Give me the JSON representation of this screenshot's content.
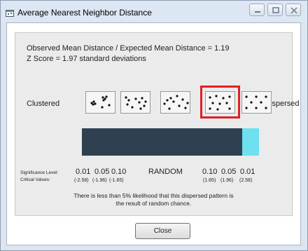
{
  "window": {
    "title": "Average Nearest Neighbor Distance"
  },
  "results": {
    "ratio_text": "Observed Mean Distance / Expected Mean Distance = 1.19",
    "zscore_text": "Z Score = 1.97 standard deviations"
  },
  "pattern_scale": {
    "left_label": "Clustered",
    "right_label": "Dispersed",
    "selected_index": 3,
    "thumbnail_count": 5
  },
  "significance": {
    "level_label": "Significance Level:",
    "critical_label": "Critical Values:",
    "left_levels": [
      "0.01",
      "0.05",
      "0.10"
    ],
    "left_criticals": [
      "(-2.58)",
      "(-1.96)",
      "(-1.65)"
    ],
    "center_label": "RANDOM",
    "right_levels": [
      "0.10",
      "0.05",
      "0.01"
    ],
    "right_criticals": [
      "(1.65)",
      "(1.96)",
      "(2.58)"
    ]
  },
  "conclusion": {
    "line1": "There is less than 5% likelihood that this dispersed pattern is",
    "line2": "the result of random chance."
  },
  "buttons": {
    "close_label": "Close"
  },
  "colors": {
    "bar": "#2f4050",
    "highlight_segment": "#6ee0f0",
    "selection_border": "#e21f26"
  }
}
